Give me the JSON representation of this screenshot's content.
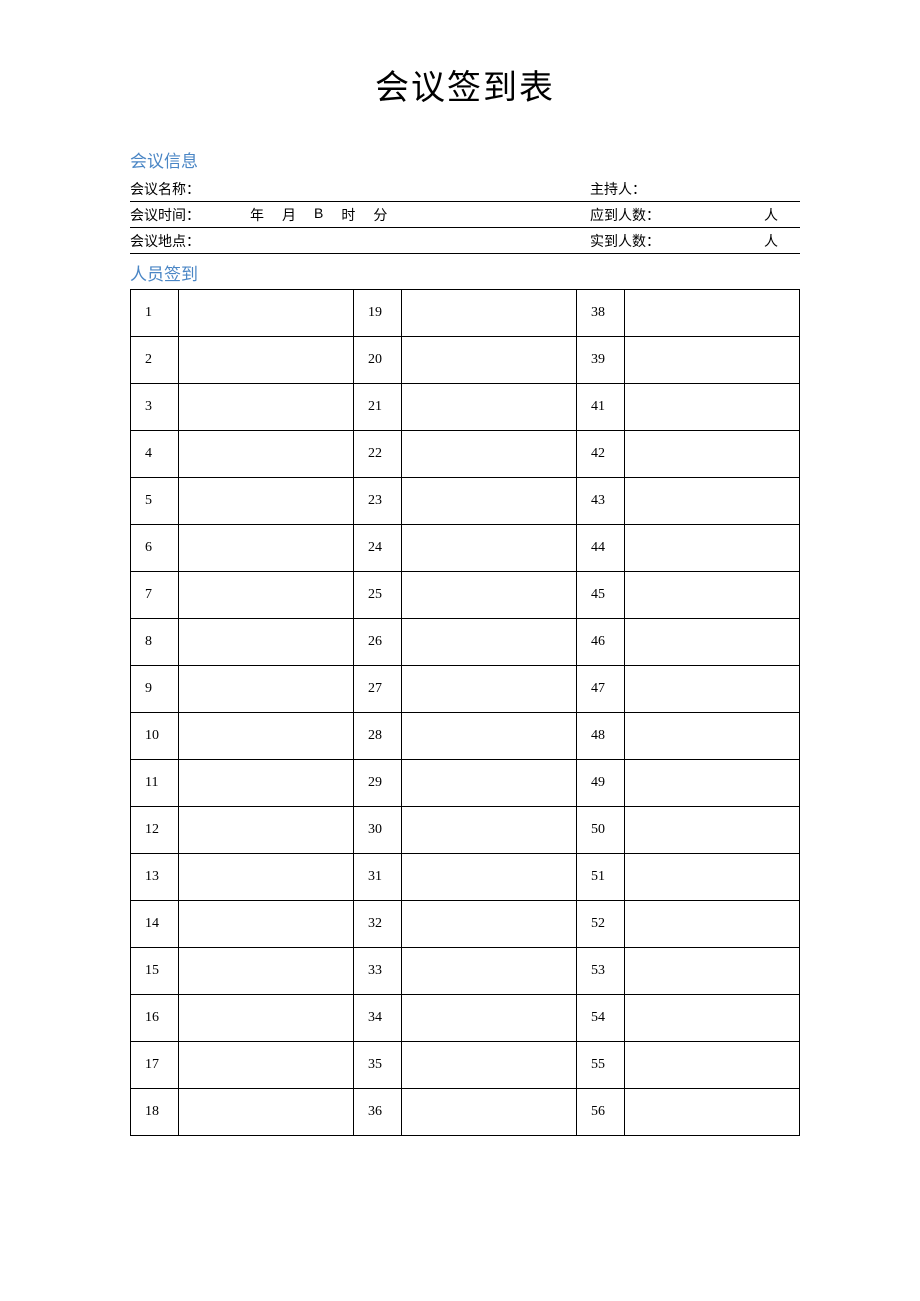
{
  "title": "会议签到表",
  "section_info": "会议信息",
  "section_signin": "人员签到",
  "info": {
    "name_label": "会议名称：",
    "host_label": "主持人：",
    "time_label": "会议时间：",
    "expected_label": "应到人数：",
    "location_label": "会议地点：",
    "actual_label": "实到人数：",
    "unit_year": "年",
    "unit_month": "月",
    "unit_b": "B",
    "unit_hour": "时",
    "unit_minute": "分",
    "unit_person": "人"
  },
  "signin": {
    "col1": [
      "1",
      "2",
      "3",
      "4",
      "5",
      "6",
      "7",
      "8",
      "9",
      "10",
      "11",
      "12",
      "13",
      "14",
      "15",
      "16",
      "17",
      "18"
    ],
    "col2": [
      "19",
      "20",
      "21",
      "22",
      "23",
      "24",
      "25",
      "26",
      "27",
      "28",
      "29",
      "30",
      "31",
      "32",
      "33",
      "34",
      "35",
      "36"
    ],
    "col3": [
      "38",
      "39",
      "41",
      "42",
      "43",
      "44",
      "45",
      "46",
      "47",
      "48",
      "49",
      "50",
      "51",
      "52",
      "53",
      "54",
      "55",
      "56"
    ]
  }
}
